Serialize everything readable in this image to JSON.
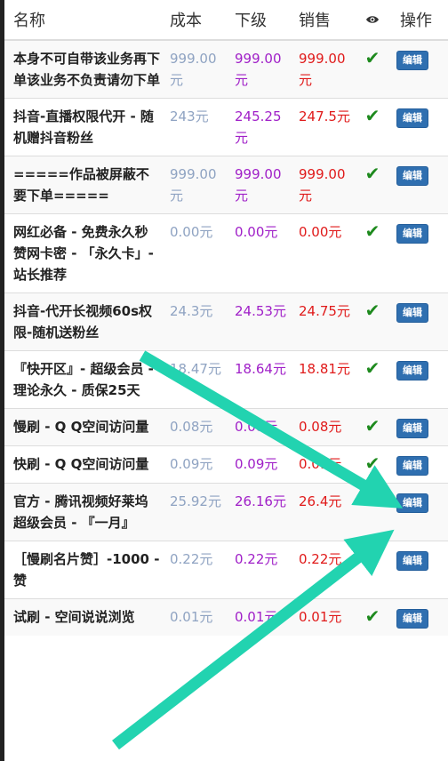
{
  "header": {
    "name": "名称",
    "cost": "成本",
    "sub": "下级",
    "sale": "销售",
    "op": "操作"
  },
  "check_glyph": "✔",
  "edit_label": "编辑",
  "rows": [
    {
      "name": "本身不可自带该业务再下单该业务不负责请勿下单",
      "cost": "999.00元",
      "sub": "999.00元",
      "sale": "999.00元"
    },
    {
      "name": "抖音-直播权限代开 - 随机赠抖音粉丝",
      "cost": "243元",
      "sub": "245.25元",
      "sale": "247.5元"
    },
    {
      "name": "=====作品被屏蔽不要下单=====",
      "cost": "999.00元",
      "sub": "999.00元",
      "sale": "999.00元"
    },
    {
      "name": "网红必备 - 免费永久秒赞网卡密 - 「永久卡」- 站长推荐",
      "cost": "0.00元",
      "sub": "0.00元",
      "sale": "0.00元"
    },
    {
      "name": "抖音-代开长视频60s权限-随机送粉丝",
      "cost": "24.3元",
      "sub": "24.53元",
      "sale": "24.75元"
    },
    {
      "name": "『快开区』- 超级会员 - 理论永久 - 质保25天",
      "cost": "18.47元",
      "sub": "18.64元",
      "sale": "18.81元"
    },
    {
      "name": "慢刷 - Q Q空间访问量",
      "cost": "0.08元",
      "sub": "0.08元",
      "sale": "0.08元"
    },
    {
      "name": "快刷 - Q Q空间访问量",
      "cost": "0.09元",
      "sub": "0.09元",
      "sale": "0.09元"
    },
    {
      "name": "官方 - 腾讯视频好莱坞超级会员 - 『一月』",
      "cost": "25.92元",
      "sub": "26.16元",
      "sale": "26.4元"
    },
    {
      "name": "［慢刷名片赞］-1000 - 赞",
      "cost": "0.22元",
      "sub": "0.22元",
      "sale": "0.22元"
    },
    {
      "name": "试刷 - 空间说说浏览",
      "cost": "0.01元",
      "sub": "0.01元",
      "sale": "0.01元"
    }
  ],
  "colors": {
    "cost": "#8fa3c2",
    "sub": "#a020c8",
    "sale": "#e01a1a",
    "check": "#1e8a1e",
    "button": "#2f6fb0",
    "annotation_arrow": "#22d3b0"
  }
}
